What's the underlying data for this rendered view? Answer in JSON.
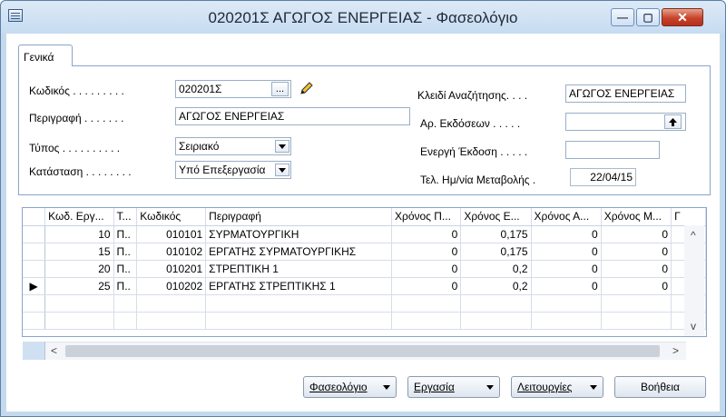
{
  "window": {
    "title": "020201Σ ΑΓΩΓΟΣ ΕΝΕΡΓΕΙΑΣ - Φασεολόγιο",
    "minimize_glyph": "—",
    "maximize_glyph": "▢",
    "close_glyph": "✕"
  },
  "tabs": [
    {
      "label": "Γενικά"
    }
  ],
  "form": {
    "code_label": "Κωδικός . . . . . . . . .",
    "code_value": "020201Σ",
    "code_button": "...",
    "description_label": "Περιγραφή . . . . . . .",
    "description_value": "ΑΓΩΓΟΣ ΕΝΕΡΓΕΙΑΣ",
    "type_label": "Τύπος . . . . . . . . . .",
    "type_value": "Σειριακό",
    "status_label": "Κατάσταση . . . . . . . .",
    "status_value": "Υπό Επεξεργασία",
    "search_key_label": "Κλειδί Αναζήτησης. . . .",
    "search_key_value": "ΑΓΩΓΟΣ ΕΝΕΡΓΕΙΑΣ",
    "versions_label": "Αρ. Εκδόσεων . . . . .",
    "versions_value": "",
    "active_version_label": "Ενεργή Έκδοση . . . . .",
    "active_version_value": "",
    "last_change_label": "Τελ. Ημ/νία Μεταβολής .",
    "last_change_value": "22/04/15"
  },
  "grid": {
    "columns": [
      "Κωδ. Εργ...",
      "Τ...",
      "Κωδικός",
      "Περιγραφή",
      "Χρόνος Π...",
      "Χρόνος Ε...",
      "Χρόνος Α...",
      "Χρόνος Μ...",
      "Γ"
    ],
    "rows": [
      {
        "marker": "",
        "work_code": "10",
        "t": "Π..",
        "code": "010101",
        "description": "ΣΥΡΜΑΤΟΥΡΓΙΚΗ",
        "p": "0",
        "e": "0,175",
        "a": "0",
        "m": "0"
      },
      {
        "marker": "",
        "work_code": "15",
        "t": "Π..",
        "code": "010102",
        "description": "ΕΡΓΑΤΗΣ ΣΥΡΜΑΤΟΥΡΓΙΚΗΣ",
        "p": "0",
        "e": "0,175",
        "a": "0",
        "m": "0"
      },
      {
        "marker": "",
        "work_code": "20",
        "t": "Π..",
        "code": "010201",
        "description": "ΣΤΡΕΠΤΙΚΗ 1",
        "p": "0",
        "e": "0,2",
        "a": "0",
        "m": "0"
      },
      {
        "marker": "▶",
        "work_code": "25",
        "t": "Π..",
        "code": "010202",
        "description": "ΕΡΓΑΤΗΣ ΣΤΡΕΠΤΙΚΗΣ 1",
        "p": "0",
        "e": "0,2",
        "a": "0",
        "m": "0"
      }
    ],
    "scroll_left": "<",
    "scroll_right": ">",
    "scroll_up": "^",
    "scroll_down": "v"
  },
  "footer": {
    "phases_label": "Φασεολόγιο",
    "work_label": "Εργασία",
    "functions_label": "Λειτουργίες",
    "help_label": "Βοήθεια"
  }
}
